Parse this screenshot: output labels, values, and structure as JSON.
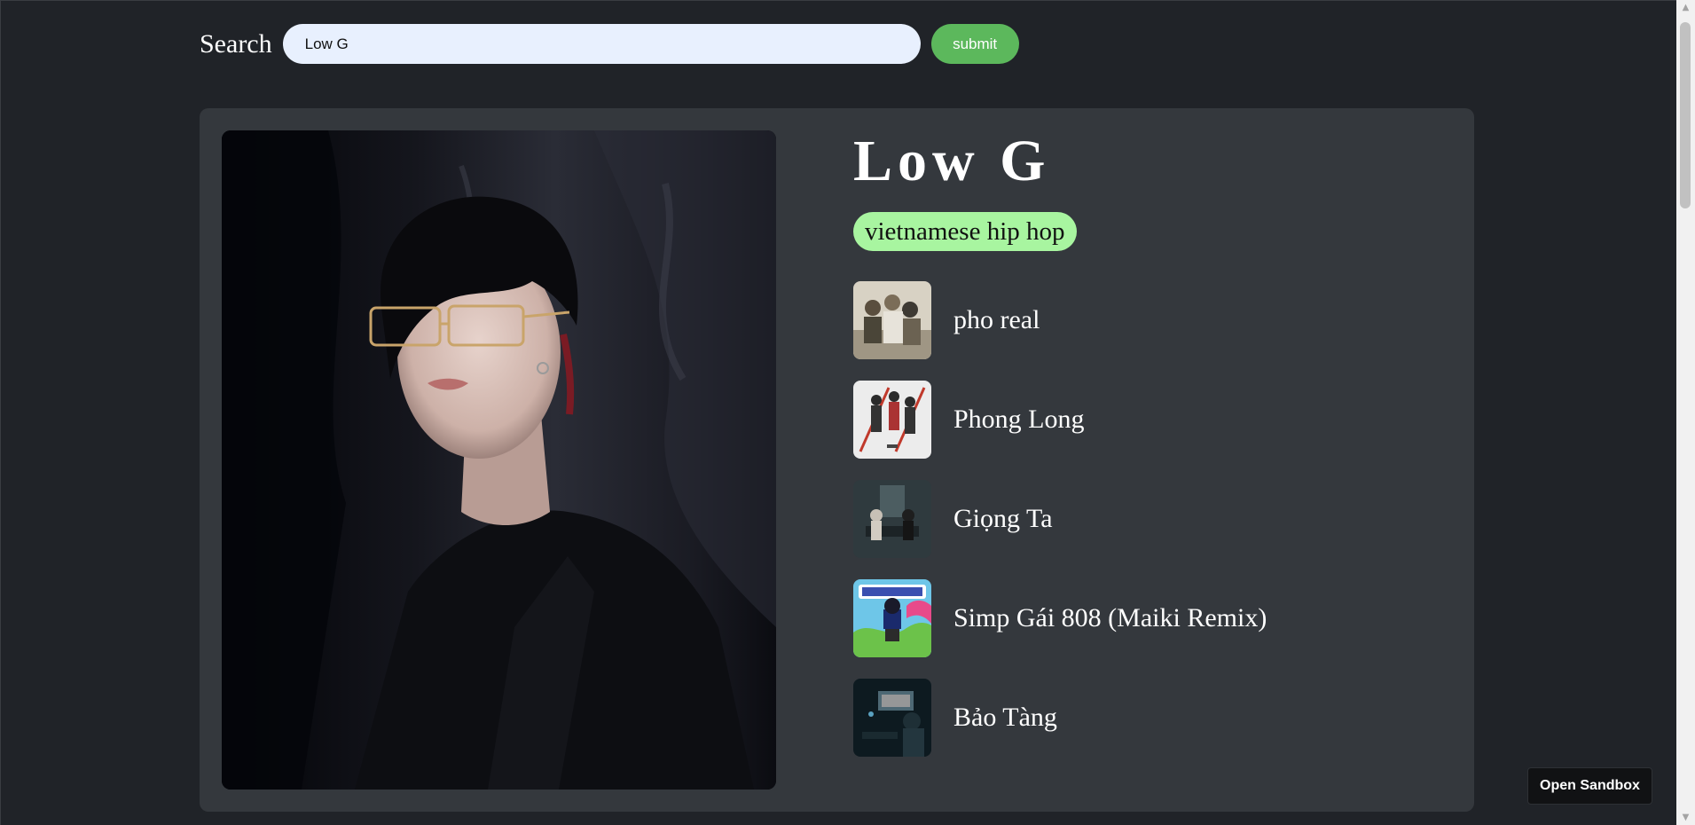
{
  "search": {
    "label": "Search",
    "value": "Low G",
    "submit_label": "submit"
  },
  "artist": {
    "name": "Low G",
    "genre": "vietnamese hip hop"
  },
  "tracks": [
    {
      "title": "pho real"
    },
    {
      "title": "Phong Long"
    },
    {
      "title": "Giọng Ta"
    },
    {
      "title": "Simp Gái 808 (Maiki Remix)"
    },
    {
      "title": "Bảo Tàng"
    }
  ],
  "sandbox": {
    "label": "Open Sandbox"
  },
  "colors": {
    "page_bg": "#202328",
    "card_bg": "#34383d",
    "submit_bg": "#5cb85c",
    "genre_bg": "#a8f5a0",
    "input_bg": "#e8f0fe"
  }
}
